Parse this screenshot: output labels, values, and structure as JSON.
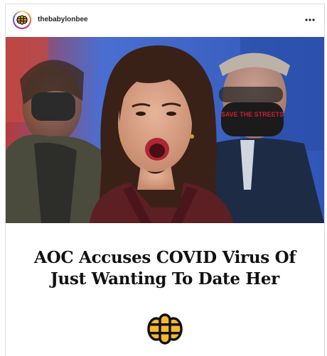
{
  "post": {
    "username": "thebabylonbee",
    "more_icon": "more-horizontal-icon",
    "avatar_icon": "babylon-bee-logo-icon",
    "image": {
      "mask_left": "",
      "mask_right": "SAVE THE STREETS"
    },
    "headline": "AOC Accuses COVID Virus Of Just Wanting To Date Her",
    "logo_icon": "babylon-bee-logo-icon"
  },
  "colors": {
    "bee_gold": "#f5b82e",
    "bee_black": "#111111",
    "coat": "#5c1f24",
    "sky": "#3b63c8"
  }
}
